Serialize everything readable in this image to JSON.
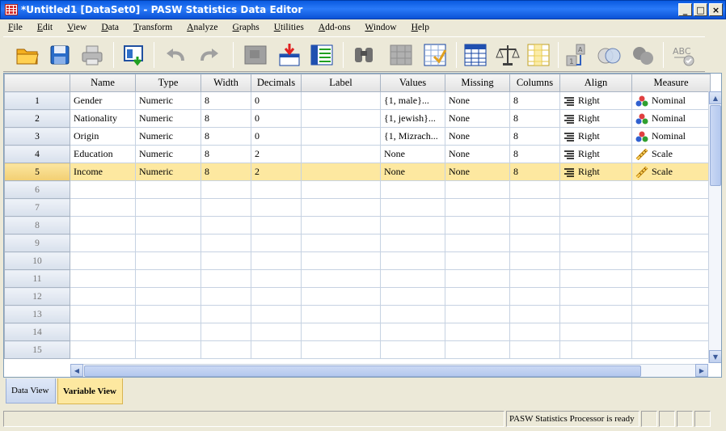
{
  "window": {
    "title": "*Untitled1 [DataSet0] - PASW Statistics Data Editor"
  },
  "menu": [
    "File",
    "Edit",
    "View",
    "Data",
    "Transform",
    "Analyze",
    "Graphs",
    "Utilities",
    "Add-ons",
    "Window",
    "Help"
  ],
  "toolbar": [
    {
      "name": "open-icon"
    },
    {
      "name": "save-icon"
    },
    {
      "name": "print-icon"
    },
    {
      "name": "dialog-recall-icon"
    },
    {
      "name": "undo-icon"
    },
    {
      "name": "redo-icon"
    },
    {
      "name": "goto-case-icon"
    },
    {
      "name": "goto-variable-icon"
    },
    {
      "name": "variables-icon"
    },
    {
      "name": "find-icon"
    },
    {
      "name": "insert-cases-icon"
    },
    {
      "name": "insert-variable-icon"
    },
    {
      "name": "split-file-icon"
    },
    {
      "name": "weight-cases-icon"
    },
    {
      "name": "select-cases-icon"
    },
    {
      "name": "value-labels-icon"
    },
    {
      "name": "use-sets-icon"
    },
    {
      "name": "show-all-icon"
    },
    {
      "name": "spelling-icon"
    }
  ],
  "columns": [
    "Name",
    "Type",
    "Width",
    "Decimals",
    "Label",
    "Values",
    "Missing",
    "Columns",
    "Align",
    "Measure"
  ],
  "rows": [
    {
      "num": "1",
      "name": "Gender",
      "type": "Numeric",
      "width": "8",
      "decimals": "0",
      "label": "",
      "values": "{1, male}...",
      "missing": "None",
      "columns": "8",
      "align": "Right",
      "measure": "Nominal",
      "measure_icon": "nominal-icon"
    },
    {
      "num": "2",
      "name": "Nationality",
      "type": "Numeric",
      "width": "8",
      "decimals": "0",
      "label": "",
      "values": "{1, jewish}...",
      "missing": "None",
      "columns": "8",
      "align": "Right",
      "measure": "Nominal",
      "measure_icon": "nominal-icon"
    },
    {
      "num": "3",
      "name": "Origin",
      "type": "Numeric",
      "width": "8",
      "decimals": "0",
      "label": "",
      "values": "{1, Mizrach...",
      "missing": "None",
      "columns": "8",
      "align": "Right",
      "measure": "Nominal",
      "measure_icon": "nominal-icon"
    },
    {
      "num": "4",
      "name": "Education",
      "type": "Numeric",
      "width": "8",
      "decimals": "2",
      "label": "",
      "values": "None",
      "missing": "None",
      "columns": "8",
      "align": "Right",
      "measure": "Scale",
      "measure_icon": "scale-icon"
    },
    {
      "num": "5",
      "name": "Income",
      "type": "Numeric",
      "width": "8",
      "decimals": "2",
      "label": "",
      "values": "None",
      "missing": "None",
      "columns": "8",
      "align": "Right",
      "measure": "Scale",
      "measure_icon": "scale-icon",
      "selected": true
    }
  ],
  "empty_rows": [
    "6",
    "7",
    "8",
    "9",
    "10",
    "11",
    "12",
    "13",
    "14",
    "15"
  ],
  "tabs": {
    "data_view": "Data View",
    "variable_view": "Variable View"
  },
  "status": {
    "processor": "PASW Statistics Processor is ready"
  }
}
